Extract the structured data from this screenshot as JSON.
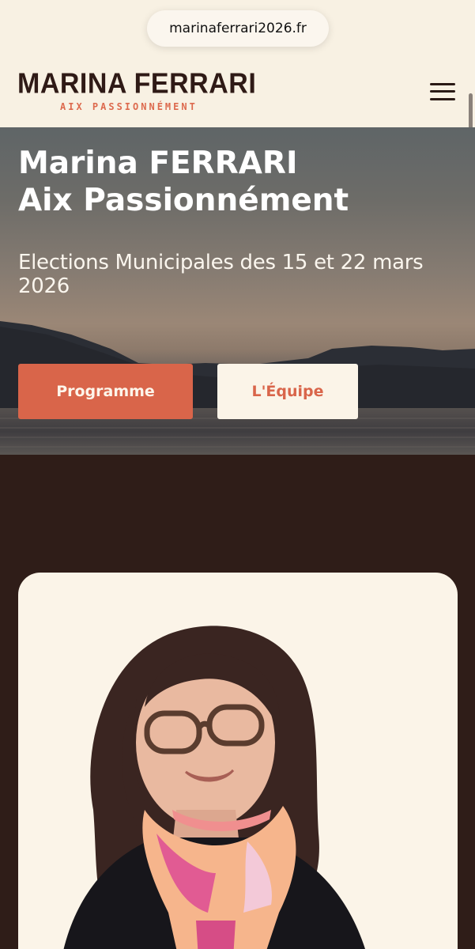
{
  "browser": {
    "url": "marinaferrari2026.fr"
  },
  "header": {
    "logo_title": "MARINA FERRARI",
    "logo_subtitle": "AIX PASSIONNÉMENT",
    "menu_icon": "hamburger-menu-icon"
  },
  "hero": {
    "title_line1": "Marina FERRARI",
    "title_line2": "Aix Passionnément",
    "subtitle": "Elections Municipales des 15 et 22 mars 2026",
    "primary_button": "Programme",
    "secondary_button": "L'Équipe"
  },
  "colors": {
    "accent": "#d9654a",
    "dark_brown": "#2f1d18",
    "cream": "#f8f1e3"
  }
}
